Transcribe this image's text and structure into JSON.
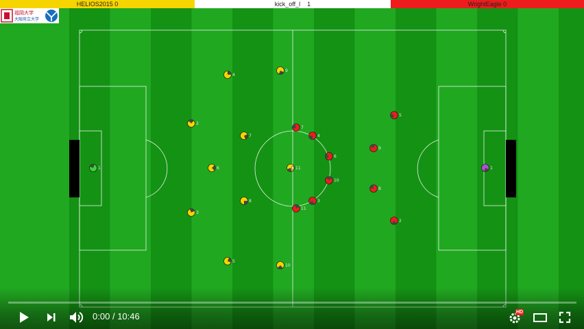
{
  "scoreboard": {
    "left_team": "HELIOS2015",
    "left_score": "0",
    "mode": "kick_off_l",
    "cycle": "1",
    "right_team": "WrightEagle",
    "right_score": "0"
  },
  "logo": {
    "text_top": "福岡大学",
    "text_bottom": "大阪府立大学"
  },
  "players": {
    "left": [
      {
        "num": "1",
        "role": "goalie"
      },
      {
        "num": "2"
      },
      {
        "num": "3"
      },
      {
        "num": "4"
      },
      {
        "num": "5"
      },
      {
        "num": "6"
      },
      {
        "num": "7"
      },
      {
        "num": "8"
      },
      {
        "num": "9"
      },
      {
        "num": "10"
      },
      {
        "num": "11"
      }
    ],
    "right": [
      {
        "num": "1",
        "role": "goalie"
      },
      {
        "num": "2"
      },
      {
        "num": "3"
      },
      {
        "num": "4"
      },
      {
        "num": "5"
      },
      {
        "num": "6"
      },
      {
        "num": "7"
      },
      {
        "num": "8"
      },
      {
        "num": "9"
      },
      {
        "num": "10"
      },
      {
        "num": "11"
      }
    ]
  },
  "colors": {
    "left_team": "#f6d400",
    "right_team": "#ee1c1c",
    "left_goalie": "#3ad13a",
    "right_goalie": "#b04fd6",
    "grass_dark": "#149214",
    "grass_light": "#21a821"
  },
  "player": {
    "progress_fraction": 0,
    "time_current": "0:00",
    "time_separator": "/",
    "time_total": "10:46",
    "badge": "HD",
    "icons": [
      "play-icon",
      "next-icon",
      "volume-icon",
      "settings-icon",
      "theater-mode-icon",
      "fullscreen-icon"
    ]
  }
}
